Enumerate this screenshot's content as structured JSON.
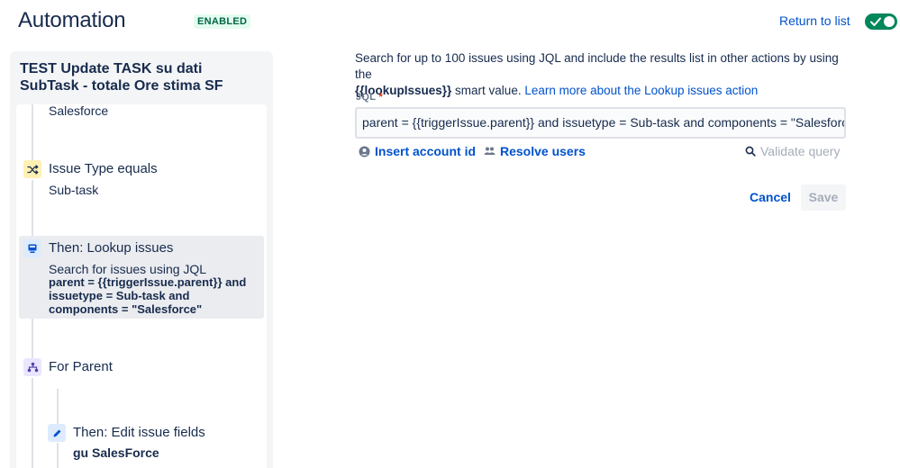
{
  "header": {
    "title": "Automation",
    "status_badge": "ENABLED",
    "return_link": "Return to list",
    "toggle_on": true
  },
  "rule": {
    "name": "TEST Update TASK su dati SubTask - totale Ore stima SF"
  },
  "flow": {
    "prev_value": "Salesforce",
    "condition": {
      "title": "Issue Type equals",
      "value": "Sub-task"
    },
    "lookup": {
      "title": "Then: Lookup issues",
      "subtitle": "Search for issues using JQL",
      "line1": "parent = {{triggerIssue.parent}} and",
      "line2": "issuetype = Sub-task and",
      "line3": "components = \"Salesforce\""
    },
    "branch": {
      "title": "For Parent"
    },
    "edit": {
      "title": "Then: Edit issue fields",
      "value": "gu SalesForce"
    }
  },
  "editor": {
    "desc_part1": "Search for up to 100 issues using JQL and include the results list in other actions by using the",
    "desc_smart_value": "{{lookupIssues}}",
    "desc_part2": " smart value. ",
    "desc_link": "Learn more about the Lookup issues action",
    "jql_label": "JQL",
    "jql_required": "*",
    "jql_value": "parent = {{triggerIssue.parent}}  and issuetype = Sub-task and components = \"Salesforce\"",
    "insert_account": "Insert account id",
    "resolve_users": "Resolve users",
    "validate_query": "Validate query",
    "cancel": "Cancel",
    "save": "Save"
  },
  "colors": {
    "accent": "#0052cc",
    "enabled_green": "#00875a",
    "condition_icon_bg": "#fff0b3",
    "action_icon_bg": "#deebff"
  }
}
